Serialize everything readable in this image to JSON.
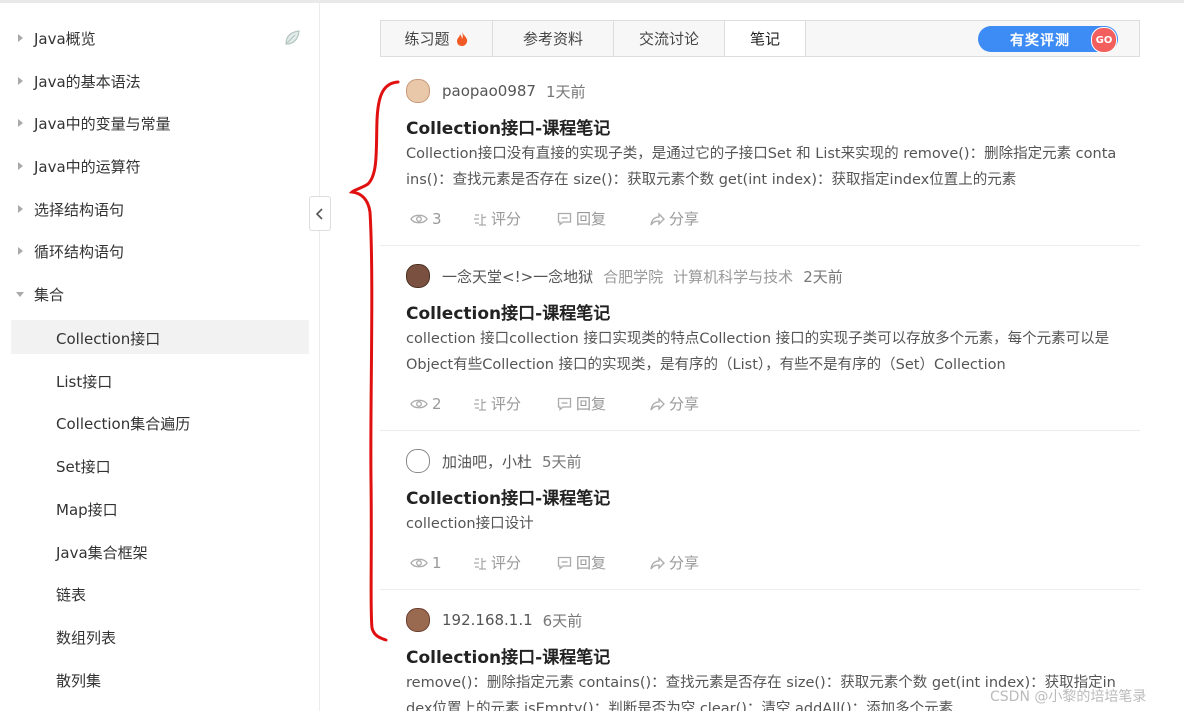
{
  "sidebar": {
    "items": [
      {
        "label": "Java概览"
      },
      {
        "label": "Java的基本语法"
      },
      {
        "label": "Java中的变量与常量"
      },
      {
        "label": "Java中的运算符"
      },
      {
        "label": "选择结构语句"
      },
      {
        "label": "循环结构语句"
      },
      {
        "label": "集合"
      }
    ],
    "subitems": [
      {
        "label": "Collection接口"
      },
      {
        "label": "List接口"
      },
      {
        "label": "Collection集合遍历"
      },
      {
        "label": "Set接口"
      },
      {
        "label": "Map接口"
      },
      {
        "label": "Java集合框架"
      },
      {
        "label": "链表"
      },
      {
        "label": "数组列表"
      },
      {
        "label": "散列集"
      }
    ]
  },
  "tabs": [
    {
      "label": "练习题"
    },
    {
      "label": "参考资料"
    },
    {
      "label": "交流讨论"
    },
    {
      "label": "笔记"
    }
  ],
  "eval_button": {
    "label": "有奖评测",
    "badge": "GO"
  },
  "notes": [
    {
      "author": "paopao0987",
      "time": "1天前",
      "title": "Collection接口-课程笔记",
      "body": "Collection接口没有直接的实现子类，是通过它的子接口Set 和 List来实现的 remove()：删除指定元素 contains()：查找元素是否存在 size()：获取元素个数 get(int index)：获取指定index位置上的元素",
      "views": "3",
      "rate": "评分",
      "reply": "回复",
      "share": "分享"
    },
    {
      "author": "一念天堂<!>一念地狱",
      "school": "合肥学院",
      "major": "计算机科学与技术",
      "time": "2天前",
      "title": "Collection接口-课程笔记",
      "body": "collection 接口collection 接口实现类的特点Collection 接口的实现子类可以存放多个元素，每个元素可以是Object有些Collection 接口的实现类，是有序的（List），有些不是有序的（Set）Collection",
      "views": "2",
      "rate": "评分",
      "reply": "回复",
      "share": "分享"
    },
    {
      "author": "加油吧，小杜",
      "time": "5天前",
      "title": "Collection接口-课程笔记",
      "body": "collection接口设计",
      "views": "1",
      "rate": "评分",
      "reply": "回复",
      "share": "分享"
    },
    {
      "author": "192.168.1.1",
      "time": "6天前",
      "title": "Collection接口-课程笔记",
      "body": "remove()：删除指定元素 contains()：查找元素是否存在 size()：获取元素个数 get(int index)：获取指定index位置上的元素 isEmpty()：判断是否为空 clear()：清空 addAll()：添加多个元素"
    }
  ],
  "watermark": "CSDN @小黎的培培笔录"
}
